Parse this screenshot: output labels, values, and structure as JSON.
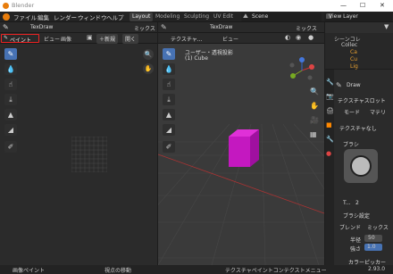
{
  "window": {
    "title": "Blender",
    "controls": [
      "—",
      "☐",
      "✕"
    ]
  },
  "menu": {
    "items": [
      "ファイル",
      "編集",
      "レンダー",
      "ウィンドウ",
      "ヘルプ"
    ],
    "workspaces": [
      "Layout",
      "Modeling",
      "Sculpting",
      "UV Edit"
    ],
    "scene_label": "Scene",
    "view_layer_label": "View Layer"
  },
  "left_editor": {
    "brush": "TexDraw",
    "blend": "ミックス",
    "mode": "ペイント",
    "menus": [
      "ビュー",
      "画像"
    ],
    "new_label": "新規",
    "open_label": "開く"
  },
  "right_editor": {
    "brush": "TexDraw",
    "blend": "ミックス",
    "mode": "テクスチャ...",
    "menus": [
      "ビュー"
    ],
    "overlay_title": "ユーザー・透視投影",
    "overlay_sub": "(1) Cube"
  },
  "outliner": {
    "title": "シーンコレ",
    "items": [
      "Collec",
      "Ca",
      "Cu",
      "Lig"
    ]
  },
  "properties": {
    "brush_name": "Draw",
    "tex_slots": "テクスチャスロット",
    "mode_label": "モード",
    "mode_value": "マテリ",
    "tex_slots_none": "テクスチャなし",
    "brush_section": "ブラシ",
    "brush_field": "T...",
    "brush_count": "2",
    "brush_settings": "ブラシ設定",
    "blend_label": "ブレンド",
    "blend_value": "ミックス",
    "radius_label": "半径",
    "radius_value": "50",
    "strength_label": "強さ",
    "strength_value": "1.0",
    "color_picker": "カラーピッカー"
  },
  "status": {
    "left": "画像ペイント",
    "mid": "視点の移動",
    "right": "テクスチャペイントコンテクストメニュー",
    "version": "2.93.0"
  },
  "accent": "#4772b3",
  "cube_color": "#d020c8"
}
